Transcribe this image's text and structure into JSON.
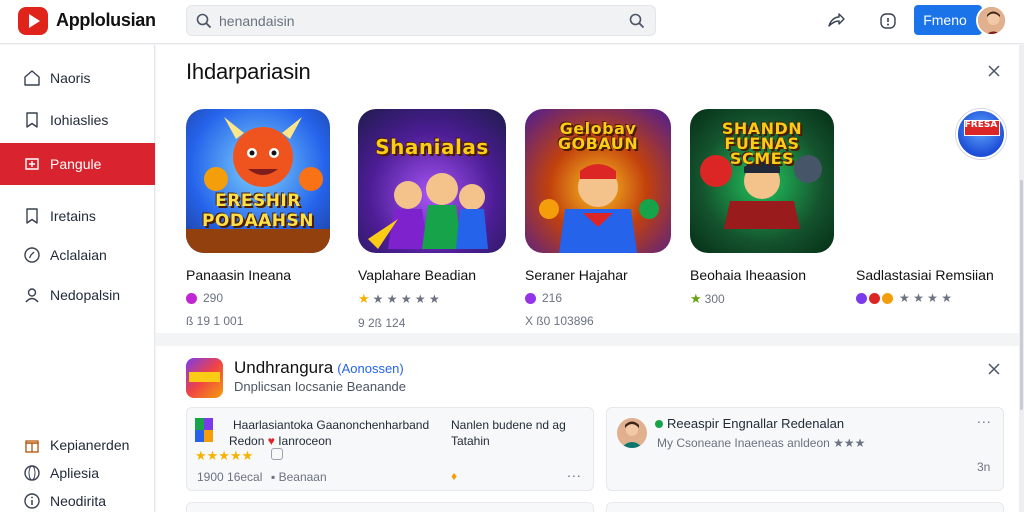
{
  "app": {
    "title": "Applolusian"
  },
  "search": {
    "placeholder": "henandaisin"
  },
  "header": {
    "primary_button": "Fmeno"
  },
  "sidebar": {
    "items": [
      {
        "label": "Naoris",
        "icon": "home-icon"
      },
      {
        "label": "Iohiaslies",
        "icon": "bookmark-icon"
      },
      {
        "label": "Pangule",
        "icon": "games-icon",
        "active": true
      },
      {
        "label": "Iretains",
        "icon": "bookmark-icon"
      },
      {
        "label": "Aclalaian",
        "icon": "compass-icon"
      },
      {
        "label": "Nedopalsin",
        "icon": "user-icon"
      }
    ],
    "bottom_items": [
      {
        "label": "Kepianerden",
        "icon": "gift-icon"
      },
      {
        "label": "Apliesia",
        "icon": "globe-icon"
      },
      {
        "label": "Neodirita",
        "icon": "info-icon"
      }
    ]
  },
  "featured": {
    "title": "Ihdarpariasin",
    "games": [
      {
        "name": "Panaasin Ineana",
        "art_title": "ERESHIR PODAAHSN",
        "rating": "290",
        "sub": "ß 19 1 001"
      },
      {
        "name": "Vaplahare Beadian",
        "art_title": "Shanialas",
        "rating": "★ ★ ★ ★ ★",
        "sub": "9 2ß 124"
      },
      {
        "name": "Seraner Hajahar",
        "art_title": "Gelobav GOBAUN",
        "rating": "216",
        "sub": "X ß0 103896"
      },
      {
        "name": "Beohaia Iheaasion",
        "art_title": "SHANDN FUENAS SCMES",
        "rating": "300",
        "sub": ""
      },
      {
        "name": "Sadlastasiai Remsiian",
        "art_title": "FRESA",
        "rating": "★ ★ ★ ★",
        "sub": ""
      }
    ]
  },
  "updates": {
    "title": "Undhrangura",
    "tag": "(Aonossen)",
    "subtitle": "Dnplicsan Iocsanie Beanande",
    "reviews": [
      {
        "title": "Haarlasiantoka Gaanonchenharband",
        "line2": "Redon",
        "line2_rest": "Ianroceon",
        "stars": "★★★★★",
        "meta": "1900 16ecal",
        "meta2": "Beanaan",
        "right_title": "Nanlen budene nd ag",
        "right_sub": "Tatahin",
        "more": "..."
      },
      {
        "title": "Reeaspir Engnallar Redenalan",
        "line2": "My Csoneane Inaeneas anldeon ★★★",
        "count": "3n",
        "more": "..."
      }
    ]
  },
  "colors": {
    "accent": "#d9232e",
    "primary_button": "#1a73e8",
    "link": "#2563eb"
  }
}
